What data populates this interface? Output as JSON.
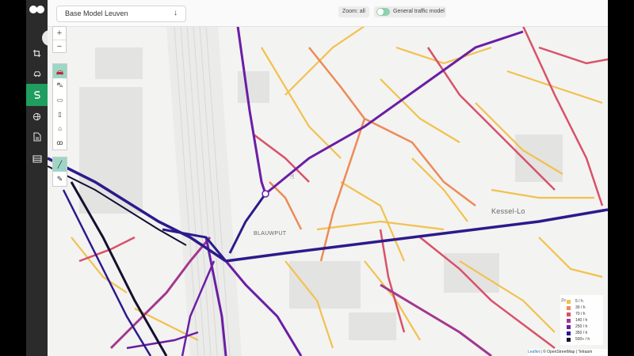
{
  "header": {
    "model_select": {
      "value": "Base Model Leuven",
      "arrow_icon": "arrow-down-icon"
    },
    "zoom_label": "Zoom: all",
    "traffic_model": {
      "label": "General traffic model",
      "enabled": true
    }
  },
  "sidebar": {
    "items": [
      {
        "icon": "crop-icon",
        "active": false
      },
      {
        "icon": "car-settings-icon",
        "active": false
      },
      {
        "icon": "route-s-icon",
        "active": true
      },
      {
        "icon": "globe-icon",
        "active": false
      },
      {
        "icon": "document-icon",
        "active": false
      },
      {
        "icon": "layers-icon",
        "active": false
      }
    ]
  },
  "map": {
    "zoom_in": "+",
    "zoom_out": "−",
    "mode_buttons": [
      {
        "icon": "car-icon",
        "active": true
      },
      {
        "icon": "car-outline-icon",
        "active": false
      },
      {
        "icon": "truck-icon",
        "active": false
      },
      {
        "icon": "bus-icon",
        "active": false
      },
      {
        "icon": "house-icon",
        "active": false
      },
      {
        "icon": "bicycle-icon",
        "active": false
      },
      {
        "icon": "bicycle-outline-icon",
        "active": false
      }
    ],
    "tools": [
      {
        "icon": "line-draw-icon",
        "active": true
      },
      {
        "icon": "pipette-icon",
        "active": false
      }
    ],
    "places": [
      "Kessel-Lo",
      "BLAUWPUT"
    ],
    "attribution": {
      "leaflet": "Leaflet",
      "rest": "| © OpenStreetMap | Telraam"
    }
  },
  "legend": {
    "unit": "Zo",
    "items": [
      {
        "label": "5 / h",
        "color": "#f2c14e"
      },
      {
        "label": "30 / h",
        "color": "#ed8a57"
      },
      {
        "label": "70 / h",
        "color": "#d9516a"
      },
      {
        "label": "140 / h",
        "color": "#a3378f"
      },
      {
        "label": "250 / h",
        "color": "#6a1ea4"
      },
      {
        "label": "350 / h",
        "color": "#2c1a8c"
      },
      {
        "label": "500+ / h",
        "color": "#141030"
      }
    ]
  }
}
